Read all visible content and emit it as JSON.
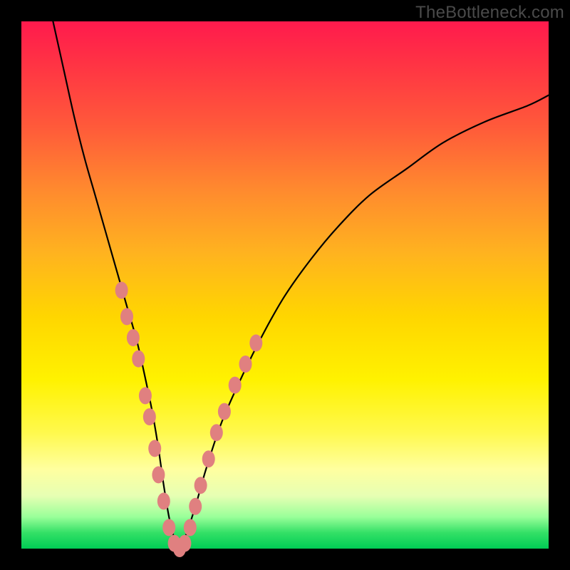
{
  "watermark": "TheBottleneck.com",
  "chart_data": {
    "type": "line",
    "title": "",
    "xlabel": "",
    "ylabel": "",
    "ylim": [
      0,
      100
    ],
    "xlim": [
      0,
      100
    ],
    "series": [
      {
        "name": "bottleneck-curve",
        "x": [
          6,
          8,
          10,
          12,
          14,
          16,
          18,
          20,
          22,
          24,
          25,
          26,
          27,
          28,
          29,
          30,
          31,
          33,
          35,
          38,
          42,
          46,
          50,
          55,
          60,
          66,
          73,
          80,
          88,
          96,
          100
        ],
        "values": [
          100,
          91,
          82,
          74,
          67,
          60,
          53,
          46,
          39,
          30,
          25,
          19,
          12,
          6,
          2,
          0,
          2,
          8,
          15,
          24,
          33,
          41,
          48,
          55,
          61,
          67,
          72,
          77,
          81,
          84,
          86
        ]
      }
    ],
    "markers": {
      "name": "beads",
      "color": "#e08080",
      "points": [
        {
          "x": 19.0,
          "y": 49
        },
        {
          "x": 20.0,
          "y": 44
        },
        {
          "x": 21.2,
          "y": 40
        },
        {
          "x": 22.2,
          "y": 36
        },
        {
          "x": 23.5,
          "y": 29
        },
        {
          "x": 24.3,
          "y": 25
        },
        {
          "x": 25.3,
          "y": 19
        },
        {
          "x": 26.0,
          "y": 14
        },
        {
          "x": 27.0,
          "y": 9
        },
        {
          "x": 28.0,
          "y": 4
        },
        {
          "x": 29.0,
          "y": 1
        },
        {
          "x": 30.0,
          "y": 0
        },
        {
          "x": 31.0,
          "y": 1
        },
        {
          "x": 32.0,
          "y": 4
        },
        {
          "x": 33.0,
          "y": 8
        },
        {
          "x": 34.0,
          "y": 12
        },
        {
          "x": 35.5,
          "y": 17
        },
        {
          "x": 37.0,
          "y": 22
        },
        {
          "x": 38.5,
          "y": 26
        },
        {
          "x": 40.5,
          "y": 31
        },
        {
          "x": 42.5,
          "y": 35
        },
        {
          "x": 44.5,
          "y": 39
        }
      ]
    },
    "gradient_bands": [
      {
        "color": "#ff1a4d",
        "stop": 0
      },
      {
        "color": "#ffd600",
        "stop": 56
      },
      {
        "color": "#00cc55",
        "stop": 100
      }
    ]
  }
}
